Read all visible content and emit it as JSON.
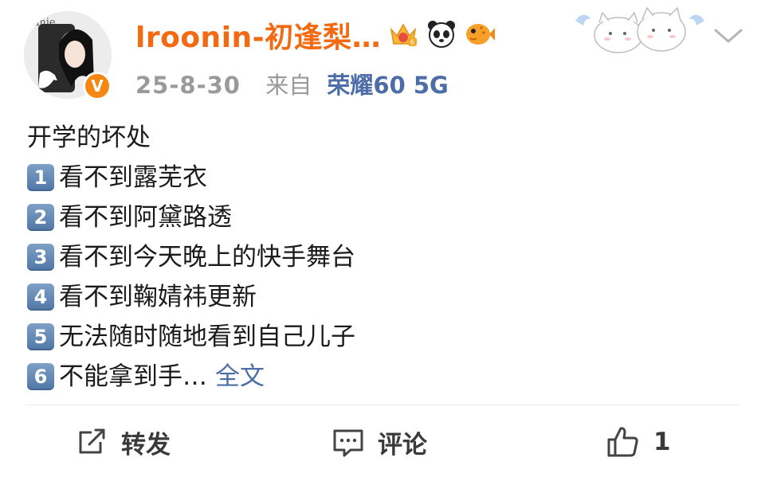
{
  "post": {
    "username": "lroonin-初逢梨…",
    "verified_mark": "V",
    "time": "25-8-30",
    "from_label": "来自",
    "device": "荣耀60 5G",
    "badges": [
      "crown-badge-icon",
      "panda-icon",
      "pufferfish-icon"
    ],
    "lines": [
      {
        "marker": "",
        "text": "开学的坏处"
      },
      {
        "marker": "1",
        "text": "看不到露芜衣"
      },
      {
        "marker": "2",
        "text": "看不到阿黛路透"
      },
      {
        "marker": "3",
        "text": "看不到今天晚上的快手舞台"
      },
      {
        "marker": "4",
        "text": "看不到鞠婧祎更新"
      },
      {
        "marker": "5",
        "text": "无法随时随地看到自己儿子"
      },
      {
        "marker": "6",
        "text": "不能拿到手…"
      }
    ],
    "more_link": "全文"
  },
  "actions": {
    "repost_label": "转发",
    "comment_label": "评论",
    "like_count": "1"
  },
  "colors": {
    "username": "#f26a12",
    "link": "#4d6da8",
    "meta": "#9a9a9a",
    "verified": "#f5860f"
  }
}
